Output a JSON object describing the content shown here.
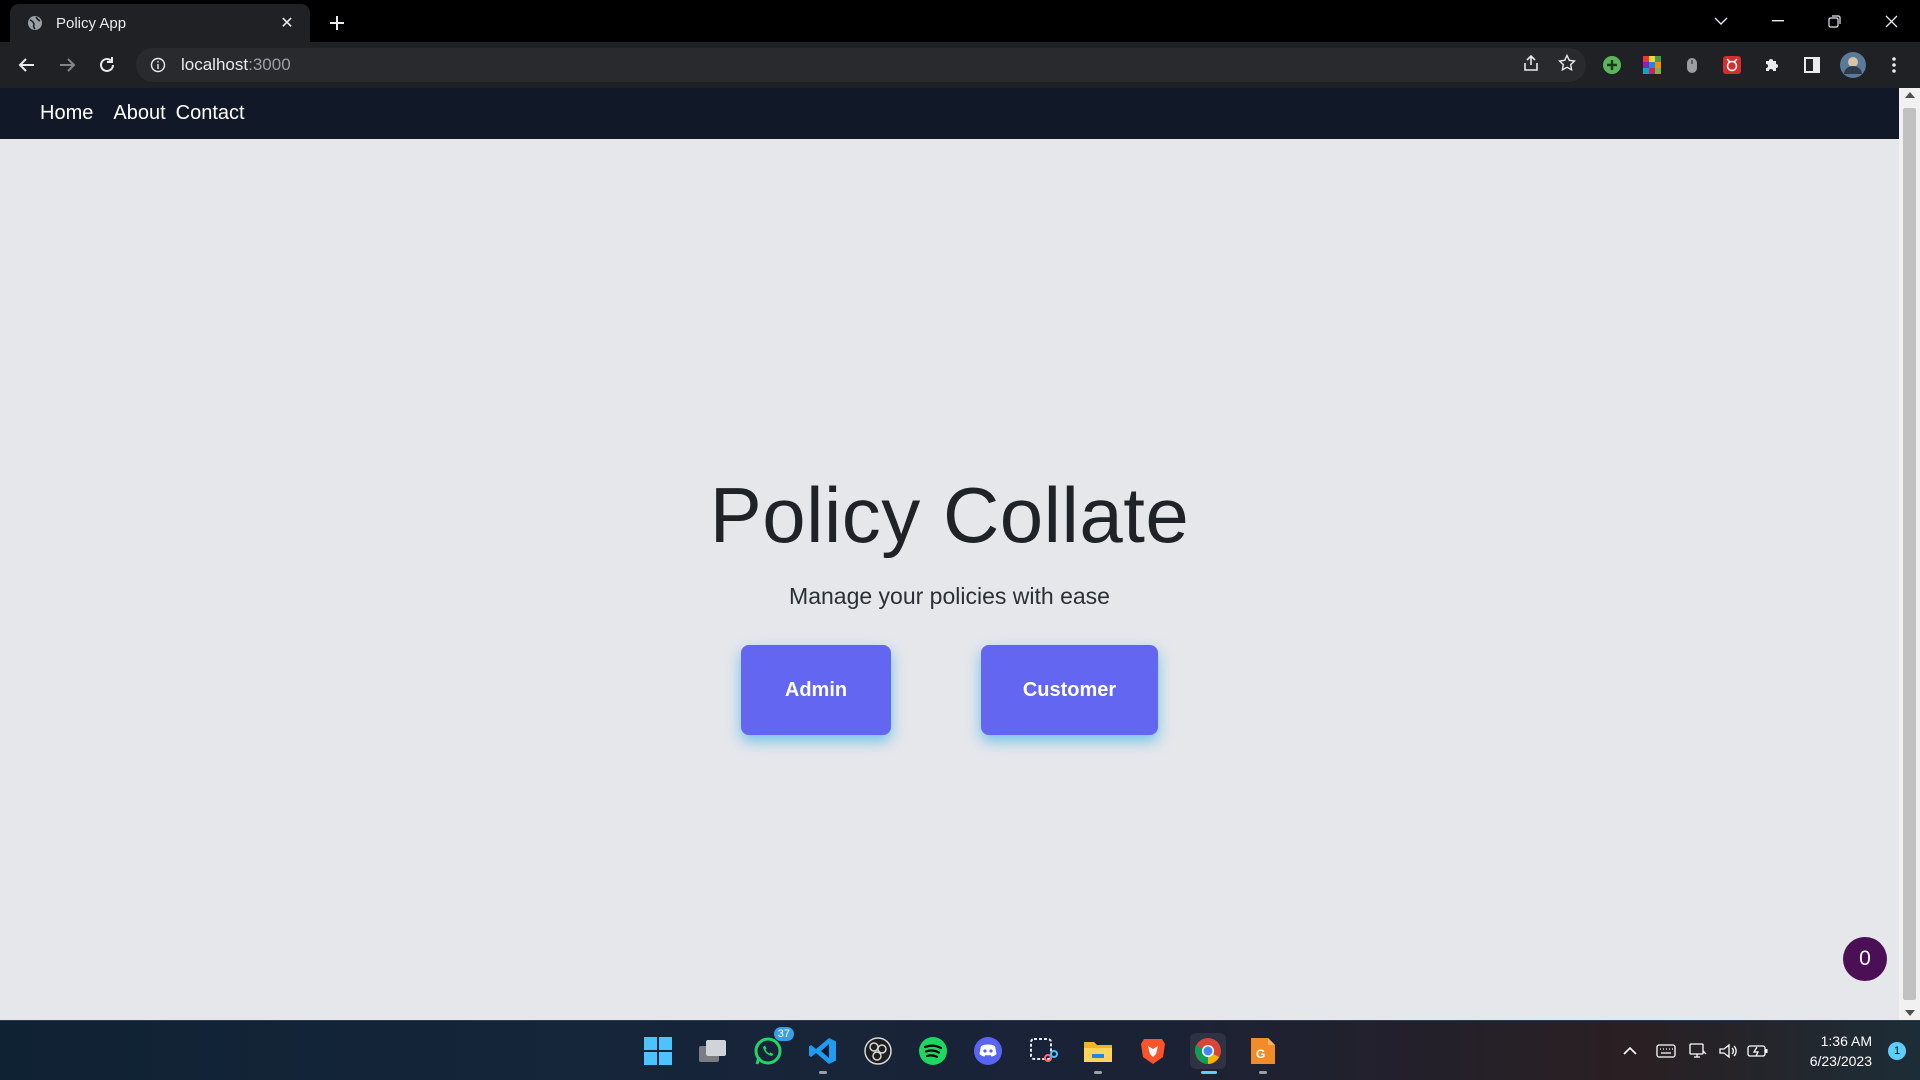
{
  "browser": {
    "tab_title": "Policy App",
    "url_host": "localhost",
    "url_port": ":3000"
  },
  "navbar": {
    "links": [
      "Home",
      "About",
      "Contact"
    ]
  },
  "hero": {
    "title": "Policy Collate",
    "subtitle": "Manage your policies with ease",
    "admin_label": "Admin",
    "customer_label": "Customer"
  },
  "floating_badge": "0",
  "taskbar": {
    "whatsapp_badge": "37",
    "time": "1:36 AM",
    "date": "6/23/2023",
    "notification_count": "1"
  },
  "colors": {
    "navbar_bg": "#111827",
    "page_bg": "#e5e7eb",
    "button_bg": "#6366f1",
    "button_glow": "#0ea5e9",
    "badge_bg": "#4a0f55"
  }
}
